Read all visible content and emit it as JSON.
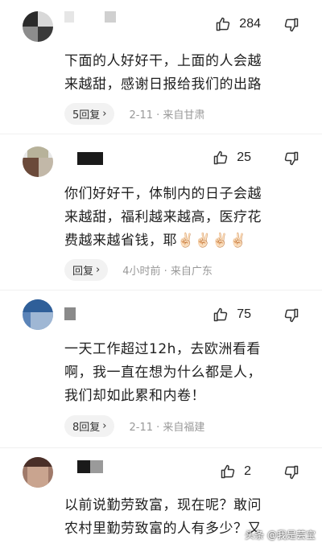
{
  "comments": [
    {
      "likes": "284",
      "text_lines": [
        "下面的人好好干，上面的人会越",
        "来越甜，感谢日报给我们的出路"
      ],
      "reply_label": "5回复",
      "meta": "2-11 · 来自甘肃"
    },
    {
      "likes": "25",
      "text_lines": [
        "你们好好干，体制内的日子会越",
        "来越甜，福利越来越高，医疗花",
        "费越来越省钱，耶✌🏻✌🏻✌🏻✌🏻"
      ],
      "reply_label": "回复",
      "meta": "4小时前 · 来自广东"
    },
    {
      "likes": "75",
      "text_lines": [
        "一天工作超过12h，去欧洲看看",
        "啊，我一直在想为什么都是人，",
        "我们却如此累和内卷！"
      ],
      "reply_label": "8回复",
      "meta": "2-11 · 来自福建"
    },
    {
      "likes": "2",
      "text_lines": [
        "以前说勤劳致富，现在呢？敢问",
        "农村里勤劳致富的人有多少？又"
      ],
      "reply_label": "",
      "meta": ""
    }
  ],
  "watermark": "头条 @我是芸宝",
  "icons": {
    "like": "thumbs-up-icon",
    "dislike": "thumbs-down-icon",
    "chevron": "chevron-right-icon"
  }
}
